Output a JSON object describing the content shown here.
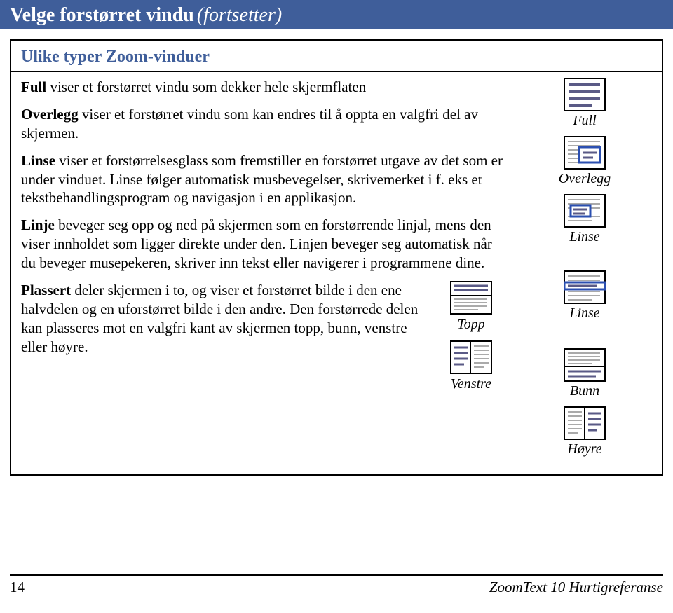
{
  "header": {
    "title": "Velge forstørret vindu",
    "suffix": "(fortsetter)"
  },
  "subtitle": "Ulike typer Zoom-vinduer",
  "paragraphs": {
    "full": {
      "bold": "Full",
      "rest": " viser et forstørret vindu som dekker hele skjermflaten"
    },
    "overlegg": {
      "bold": "Overlegg",
      "rest": " viser et forstørret vindu som kan endres til å oppta en valgfri del av skjermen."
    },
    "linse": {
      "bold": "Linse",
      "rest": " viser et forstørrelsesglass som fremstiller en forstørret utgave av det som er under vinduet. Linse følger automatisk musbevegelser, skrivemerket i f. eks et tekstbehandlingsprogram og navigasjon i en applikasjon."
    },
    "linje": {
      "bold": "Linje",
      "rest": " beveger seg opp og ned på skjermen som en forstørrende linjal, mens den viser innholdet som ligger direkte under den. Linjen beveger seg automatisk når du beveger musepekeren, skriver inn tekst eller navigerer i programmene dine."
    },
    "plassert": {
      "bold": "Plassert",
      "rest": " deler skjermen i to, og viser et forstørret bilde i den ene halvdelen og en uforstørret bilde i den andre. Den forstørrede delen kan plasseres mot en valgfri kant av skjermen topp, bunn, venstre eller høyre."
    }
  },
  "icons": {
    "full": "Full",
    "overlegg": "Overlegg",
    "linse1": "Linse",
    "linse2": "Linse",
    "topp": "Topp",
    "bunn": "Bunn",
    "venstre": "Venstre",
    "hoyre": "Høyre"
  },
  "footer": {
    "page": "14",
    "ref": "ZoomText 10 Hurtigreferanse"
  }
}
